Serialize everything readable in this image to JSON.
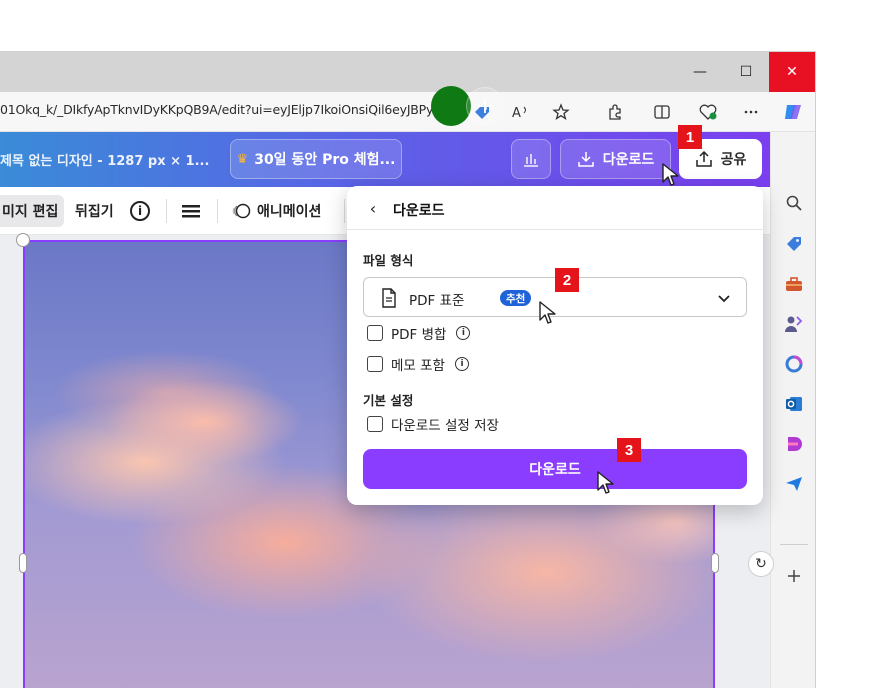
{
  "browser": {
    "url": "01Okq_k/_DIkfyApTknvIDyKKpQB9A/edit?ui=eyJEljp7IkoiOnsiQil6eyJBPyI...",
    "window_controls": {
      "minimize": "—",
      "maximize": "☐",
      "close": "✕"
    }
  },
  "header": {
    "doc_title": "제목 없는 디자인 - 1287 px × 1...",
    "pro_button": "30일 동안 Pro 체험...",
    "plus": "+",
    "download": "다운로드",
    "share": "공유"
  },
  "toolbar": {
    "edit": "미지 편집",
    "flip": "뒤집기",
    "info": "i",
    "animate": "애니메이션"
  },
  "panel": {
    "back": "‹",
    "title": "다운로드",
    "file_format_label": "파일 형식",
    "format_value": "PDF 표준",
    "format_badge": "추천",
    "merge_pdf": "PDF 병합",
    "include_notes": "메모 포함",
    "basic_settings_label": "기본 설정",
    "save_settings": "다운로드 설정 저장",
    "download_button": "다운로드",
    "info_glyph": "i"
  },
  "steps": {
    "one": "1",
    "two": "2",
    "three": "3"
  },
  "canvas": {
    "rotate": "↻"
  },
  "colors": {
    "accent": "#8b3dff",
    "step_badge": "#e5141b",
    "badge_blue": "#1e63d8"
  }
}
